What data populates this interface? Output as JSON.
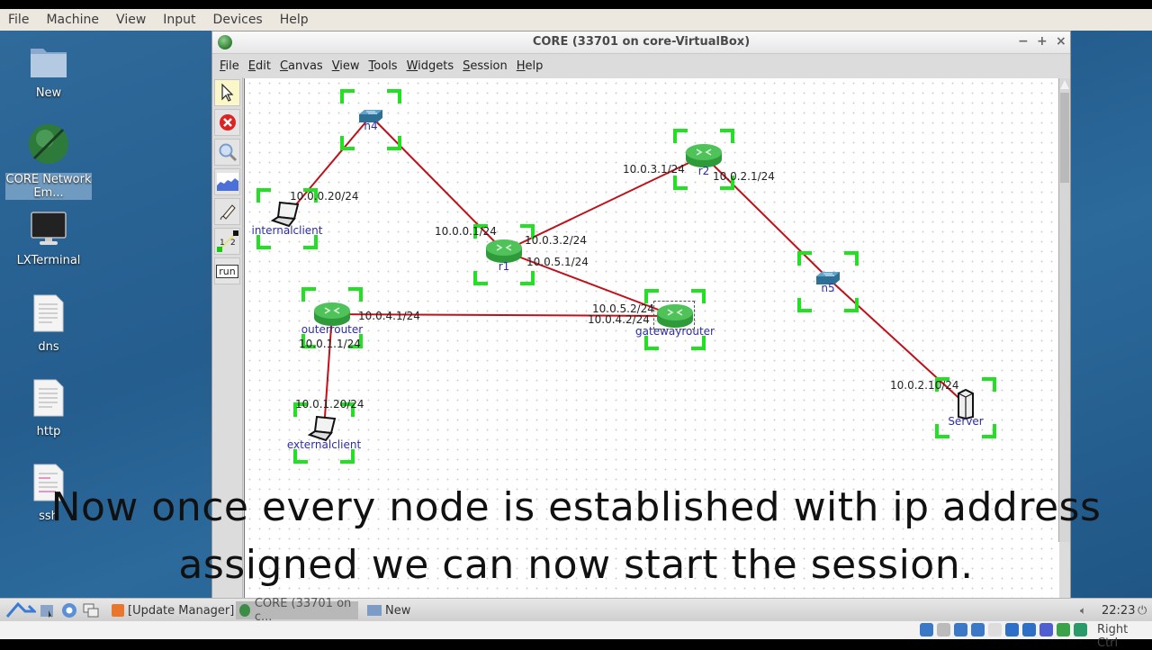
{
  "vbox_menu": [
    "File",
    "Machine",
    "View",
    "Input",
    "Devices",
    "Help"
  ],
  "desktop_icons": [
    {
      "label": "New",
      "icon": "folder-icon"
    },
    {
      "label": "CORE Network Em...",
      "icon": "core-app-icon"
    },
    {
      "label": "LXTerminal",
      "icon": "terminal-icon"
    },
    {
      "label": "dns",
      "icon": "document-icon"
    },
    {
      "label": "http",
      "icon": "document-icon"
    },
    {
      "label": "ssh",
      "icon": "document-icon"
    }
  ],
  "window": {
    "title": "CORE (33701 on core-VirtualBox)",
    "controls": {
      "minimize": "−",
      "maximize": "+",
      "close": "×"
    },
    "menu": [
      "File",
      "Edit",
      "Canvas",
      "View",
      "Tools",
      "Widgets",
      "Session",
      "Help"
    ]
  },
  "toolbar": {
    "tools": [
      {
        "name": "select-tool",
        "active": true
      },
      {
        "name": "stop-tool",
        "active": false
      },
      {
        "name": "zoom-tool",
        "active": false
      },
      {
        "name": "plot-tool",
        "active": false
      },
      {
        "name": "marker-tool",
        "active": false
      },
      {
        "name": "two-node-tool",
        "label": "1 2",
        "active": false
      },
      {
        "name": "run-tool",
        "label": "run",
        "active": false
      }
    ]
  },
  "network": {
    "nodes": [
      {
        "id": "n4",
        "label": "n4",
        "type": "switch"
      },
      {
        "id": "internalclient",
        "label": "internalclient",
        "type": "laptop"
      },
      {
        "id": "r1",
        "label": "r1",
        "type": "router"
      },
      {
        "id": "r2",
        "label": "r2",
        "type": "router"
      },
      {
        "id": "n5",
        "label": "n5",
        "type": "switch"
      },
      {
        "id": "outerrouter",
        "label": "outerrouter",
        "type": "router"
      },
      {
        "id": "gatewayrouter",
        "label": "gatewayrouter",
        "type": "router"
      },
      {
        "id": "externalclient",
        "label": "externalclient",
        "type": "laptop"
      },
      {
        "id": "server",
        "label": "Server",
        "type": "server"
      }
    ],
    "links": [
      {
        "from": "internalclient",
        "to": "n4"
      },
      {
        "from": "n4",
        "to": "r1"
      },
      {
        "from": "r1",
        "to": "r2"
      },
      {
        "from": "r2",
        "to": "n5"
      },
      {
        "from": "n5",
        "to": "server"
      },
      {
        "from": "r1",
        "to": "gatewayrouter"
      },
      {
        "from": "outerrouter",
        "to": "gatewayrouter"
      },
      {
        "from": "outerrouter",
        "to": "externalclient"
      }
    ],
    "ip_labels": {
      "internalclient": "10.0.0.20/24",
      "r1_n4": "10.0.0.1/24",
      "r1_r2": "10.0.3.2/24",
      "r1_gw": "10.0.5.1/24",
      "r2_r1": "10.0.3.1/24",
      "r2_n5": "10.0.2.1/24",
      "outer_gw": "10.0.4.1/24",
      "outer_ext": "10.0.1.1/24",
      "gw_r1": "10.0.5.2/24",
      "gw_outer": "10.0.4.2/24",
      "externalclient": "10.0.1.20/24",
      "server": "10.0.2.10/24"
    },
    "link_color": "#c0101a",
    "selection_color": "#22e022"
  },
  "caption": {
    "line1": "Now once every node is established with ip address",
    "line2": "assigned we can now start the session."
  },
  "taskbar": {
    "tasks": [
      {
        "label": "[Update Manager]"
      },
      {
        "label": "CORE (33701 on c...",
        "active": true
      },
      {
        "label": "New"
      }
    ],
    "clock": "22:23"
  },
  "vbox_status": {
    "host_key": "Right Ctrl"
  }
}
